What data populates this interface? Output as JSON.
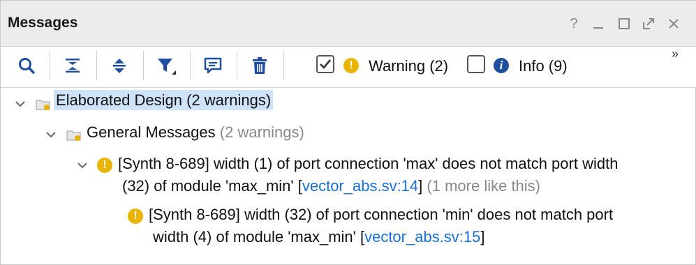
{
  "panel": {
    "title": "Messages",
    "controls": [
      "help-icon",
      "minimize-icon",
      "maximize-icon",
      "float-icon",
      "close-icon"
    ]
  },
  "toolbar": {
    "buttons": [
      "search-icon",
      "collapse-all-icon",
      "expand-all-icon",
      "filter-icon",
      "message-icon",
      "delete-icon"
    ],
    "warning_filter": {
      "checked": true,
      "label": "Warning (2)"
    },
    "info_filter": {
      "checked": false,
      "label": "Info (9)"
    },
    "overflow_glyph": "»"
  },
  "tree": {
    "root": {
      "label": "Elaborated Design (2 warnings)"
    },
    "group": {
      "label": "General Messages",
      "count": "(2 warnings)"
    },
    "messages": [
      {
        "line1": "[Synth 8-689] width (1) of port connection 'max' does not match port width",
        "line2_prefix": "(32) of module 'max_min' [",
        "link": "vector_abs.sv:14",
        "line2_suffix": "]",
        "more": "(1 more like this)"
      },
      {
        "line1": "[Synth 8-689] width (32) of port connection 'min' does not match port",
        "line2_prefix": "width (4) of module 'max_min' [",
        "link": "vector_abs.sv:15",
        "line2_suffix": "]"
      }
    ]
  },
  "colors": {
    "warning": "#e8b400",
    "info": "#1f4f9e",
    "link": "#1a6fd6",
    "selection": "#cfe3f8",
    "toolbar_icon": "#1f4f9e"
  }
}
